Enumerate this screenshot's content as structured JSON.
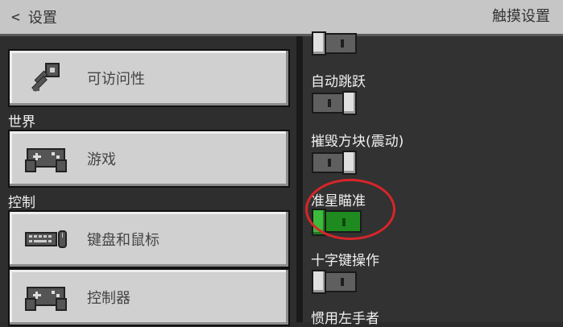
{
  "header": {
    "back_label": "设置",
    "title": "触摸设置"
  },
  "left": {
    "items": [
      {
        "label": "可访问性",
        "icon": "key-icon"
      },
      {
        "section": "世界"
      },
      {
        "label": "游戏",
        "icon": "gamepad-icon"
      },
      {
        "section": "控制"
      },
      {
        "label": "键盘和鼠标",
        "icon": "keyboard-mouse-icon"
      },
      {
        "label": "控制器",
        "icon": "gamepad-icon"
      }
    ]
  },
  "settings": [
    {
      "label": "",
      "state": "off"
    },
    {
      "label": "自动跳跃",
      "state": "off"
    },
    {
      "label": "摧毁方块(震动)",
      "state": "off"
    },
    {
      "label": "准星瞄准",
      "state": "on"
    },
    {
      "label": "十字键操作",
      "state": "off"
    },
    {
      "label": "惯用左手者"
    }
  ],
  "colors": {
    "toggle_on": "#1f8a1f",
    "highlight_circle": "#d8252a"
  }
}
